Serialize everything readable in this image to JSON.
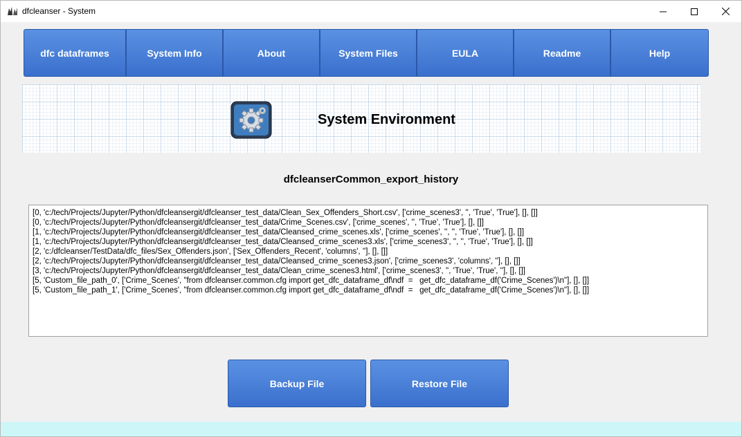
{
  "window": {
    "title": "dfcleanser - System"
  },
  "nav": {
    "items": [
      {
        "label": "dfc dataframes"
      },
      {
        "label": "System Info"
      },
      {
        "label": "About"
      },
      {
        "label": "System Files"
      },
      {
        "label": "EULA"
      },
      {
        "label": "Readme"
      },
      {
        "label": "Help"
      }
    ]
  },
  "banner": {
    "title": "System Environment",
    "icon": "gear-icon"
  },
  "history": {
    "title": "dfcleanserCommon_export_history",
    "lines": [
      "[0, 'c:/tech/Projects/Jupyter/Python/dfcleansergit/dfcleanser_test_data/Clean_Sex_Offenders_Short.csv', ['crime_scenes3', '', 'True', 'True'], [], []]",
      "[0, 'c:/tech/Projects/Jupyter/Python/dfcleansergit/dfcleanser_test_data/Crime_Scenes.csv', ['crime_scenes', '', 'True', 'True'], [], []]",
      "[1, 'c:/tech/Projects/Jupyter/Python/dfcleansergit/dfcleanser_test_data/Cleansed_crime_scenes.xls', ['crime_scenes', '', '', 'True', 'True'], [], []]",
      "[1, 'c:/tech/Projects/Jupyter/Python/dfcleansergit/dfcleanser_test_data/Cleansed_crime_scenes3.xls', ['crime_scenes3', '', '', 'True', 'True'], [], []]",
      "[2, 'c:/dfcleanser/TestData/dfc_files/Sex_Offenders.json', ['Sex_Offenders_Recent', 'columns', ''], [], []]",
      "[2, 'c:/tech/Projects/Jupyter/Python/dfcleansergit/dfcleanser_test_data/Cleansed_crime_scenes3.json', ['crime_scenes3', 'columns', ''], [], []]",
      "[3, 'c:/tech/Projects/Jupyter/Python/dfcleansergit/dfcleanser_test_data/Clean_crime_scenes3.html', ['crime_scenes3', '', 'True', 'True', ''], [], []]",
      "[5, 'Custom_file_path_0', ['Crime_Scenes', \"from dfcleanser.common.cfg import get_dfc_dataframe_df\\ndf  =   get_dfc_dataframe_df('Crime_Scenes')\\n\"], [], []]",
      "[5, 'Custom_file_path_1', ['Crime_Scenes', \"from dfcleanser.common.cfg import get_dfc_dataframe_df\\ndf  =   get_dfc_dataframe_df('Crime_Scenes')\\n\"], [], []]"
    ]
  },
  "actions": {
    "backup_label": "Backup File",
    "restore_label": "Restore File"
  },
  "colors": {
    "button": "#4a80d8",
    "footer": "#cdf6f8",
    "background": "#f0f0f0"
  }
}
